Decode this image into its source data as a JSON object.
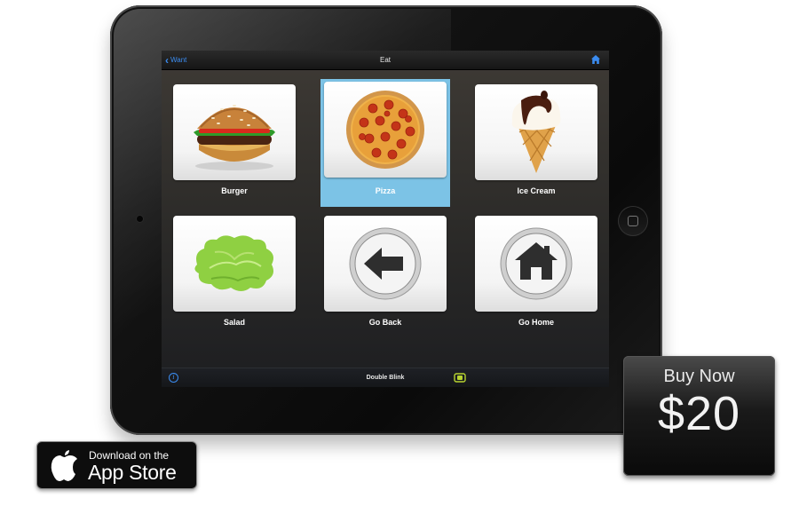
{
  "navbar": {
    "back_label": "Want",
    "title": "Eat"
  },
  "tiles": [
    {
      "label": "Burger",
      "icon": "burger-icon"
    },
    {
      "label": "Pizza",
      "icon": "pizza-icon",
      "selected": true
    },
    {
      "label": "Ice Cream",
      "icon": "ice-cream-icon"
    },
    {
      "label": "Salad",
      "icon": "salad-icon"
    },
    {
      "label": "Go Back",
      "icon": "back-arrow-icon"
    },
    {
      "label": "Go Home",
      "icon": "home-icon"
    }
  ],
  "bottombar": {
    "info_glyph": "i",
    "mode_label": "Double Blink"
  },
  "buy_now": {
    "label": "Buy Now",
    "price": "$20"
  },
  "app_store": {
    "line1": "Download on the",
    "line2": "App Store"
  },
  "colors": {
    "accent_blue": "#3b8cf0",
    "selection": "#7cc3e6",
    "face_icon": "#b8d430"
  }
}
